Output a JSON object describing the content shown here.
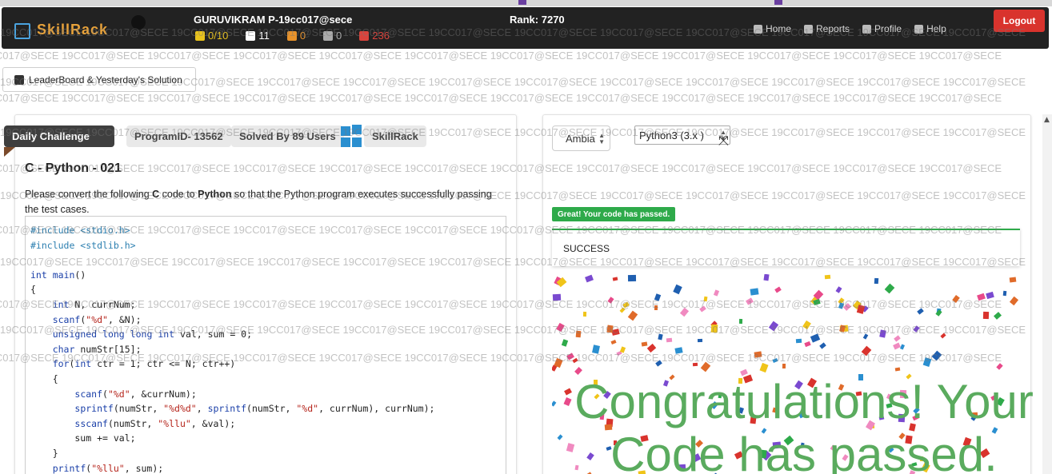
{
  "navbar": {
    "username": "GURUVIKRAM P-19cc017@sece",
    "rank": "Rank: 7270",
    "stats": [
      {
        "icon": "trophy-icon",
        "value": "0/10",
        "color": "#e8c21c"
      },
      {
        "icon": "graduation-cap-icon",
        "value": "11",
        "color": "#ffffff"
      },
      {
        "icon": "medal-icon",
        "value": "0",
        "color": "#e8922a"
      },
      {
        "icon": "silver-medal-icon",
        "value": "0",
        "color": "#aaaaaa"
      },
      {
        "icon": "bug-icon",
        "value": "236",
        "color": "#d9433c"
      }
    ],
    "links": [
      {
        "icon": "home-icon",
        "label": "Home"
      },
      {
        "icon": "reports-icon",
        "label": "Reports"
      },
      {
        "icon": "user-icon",
        "label": "Profile"
      },
      {
        "icon": "help-icon",
        "label": "Help"
      }
    ],
    "logout_label": "Logout"
  },
  "watermark": "19CC017@SECE",
  "leaderboard_label": "LeaderBoard & Yesterday's Solution",
  "problem": {
    "tags": {
      "daily": "Daily Challenge",
      "program_id": "ProgramID- 13562",
      "solved_by": "Solved By 89 Users",
      "source": "SkillRack"
    },
    "title": "C - Python - 021",
    "desc_parts": [
      "Please convert the following ",
      "C",
      " code to ",
      "Python",
      " so that the Python program executes successfully passing the test cases."
    ],
    "code_lines": [
      "#include <stdio.h>",
      "#include <stdlib.h>",
      "",
      "int main()",
      "{",
      "    int N, currNum;",
      "    scanf(\"%d\", &N);",
      "    unsigned long long int val, sum = 0;",
      "    char numStr[15];",
      "    for(int ctr = 1; ctr <= N; ctr++)",
      "    {",
      "        scanf(\"%d\", &currNum);",
      "        sprintf(numStr, \"%d%d\", sprintf(numStr, \"%d\", currNum), currNum);",
      "        sscanf(numStr, \"%llu\", &val);",
      "        sum += val;",
      "    }",
      "    printf(\"%llu\", sum);"
    ]
  },
  "editor": {
    "theme_value": "Ambia",
    "language_value": "Python3 (3.x )",
    "pass_badge": "Great! Your code has passed.",
    "result": "SUCCESS",
    "congrats_line1": "Congratulations! Your",
    "congrats_line2": "Code has passed."
  },
  "colors": {
    "navbar_bg": "#222222",
    "logout": "#d9332d",
    "success_green": "#2eaa4a",
    "congrats_green": "#5aab5e"
  }
}
